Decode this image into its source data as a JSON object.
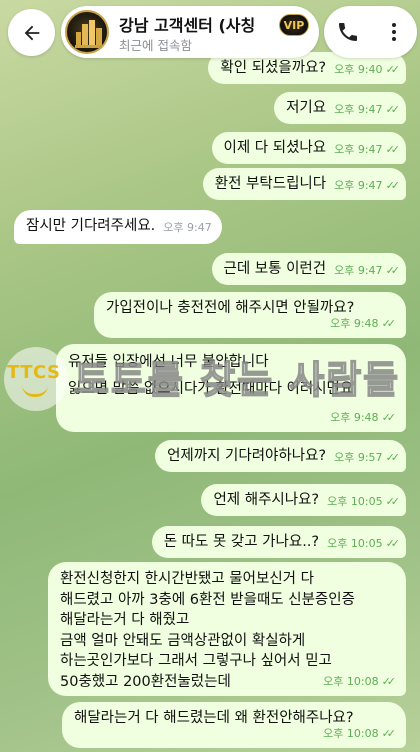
{
  "header": {
    "back_icon": "back-arrow-icon",
    "contact_name": "강남 고객센터 (사칭",
    "status": "최근에 접속함",
    "vip_badge": "VIP",
    "call_icon": "phone-icon",
    "more_icon": "more-vertical-icon"
  },
  "messages": [
    {
      "dir": "out",
      "lines": [
        "확인 되셨을까요?"
      ],
      "time": "오후 9:40",
      "read": true
    },
    {
      "dir": "out",
      "lines": [
        "저기요"
      ],
      "time": "오후 9:47",
      "read": true
    },
    {
      "dir": "out",
      "lines": [
        "이제 다 되셨나요"
      ],
      "time": "오후 9:47",
      "read": true
    },
    {
      "dir": "out",
      "lines": [
        "환전 부탁드립니다"
      ],
      "time": "오후 9:47",
      "read": true
    },
    {
      "dir": "in",
      "lines": [
        "잠시만 기다려주세요."
      ],
      "time": "오후 9:47"
    },
    {
      "dir": "out",
      "lines": [
        "근데 보통 이런건"
      ],
      "time": "오후 9:47",
      "read": true
    },
    {
      "dir": "out",
      "lines": [
        "가입전이나 충전전에 해주시면 안될까요?"
      ],
      "time": "오후 9:48",
      "read": true
    },
    {
      "dir": "out",
      "lines": [
        "유저들 입장에선 너무 불안합니다",
        "잃으면 말씀 없으시다가 환전때마다 이러시면요"
      ],
      "time": "오후 9:48",
      "read": true
    },
    {
      "dir": "out",
      "lines": [
        "언제까지 기다려야하나요?"
      ],
      "time": "오후 9:57",
      "read": true
    },
    {
      "dir": "out",
      "lines": [
        "언제 해주시나요?"
      ],
      "time": "오후 10:05",
      "read": true
    },
    {
      "dir": "out",
      "lines": [
        "돈 따도 못 갖고 가나요..?"
      ],
      "time": "오후 10:05",
      "read": true
    },
    {
      "dir": "out",
      "lines": [
        "환전신청한지 한시간반됐고 물어보신거 다",
        "해드렸고 아까 3충에 6환전 받을때도 신분증인증",
        "해달라는거 다 해줬고",
        "금액 얼마 안돼도 금액상관없이 확실하게",
        "하는곳인가보다 그래서 그렇구나 싶어서 믿고",
        "50충했고 200환전눌렀는데"
      ],
      "time": "오후 10:08",
      "read": true
    },
    {
      "dir": "out",
      "lines": [
        "해달라는거 다 해드렸는데 왜 환전안해주나요?"
      ],
      "time": "오후 10:08",
      "read": true
    }
  ],
  "watermark": {
    "logo": "TTCS",
    "text": "토토를 찾는 사람들"
  },
  "colors": {
    "outgoing_bubble": "#efffdf",
    "incoming_bubble": "#ffffff",
    "time_out": "#5fae55",
    "time_in": "#9aa0a6"
  }
}
